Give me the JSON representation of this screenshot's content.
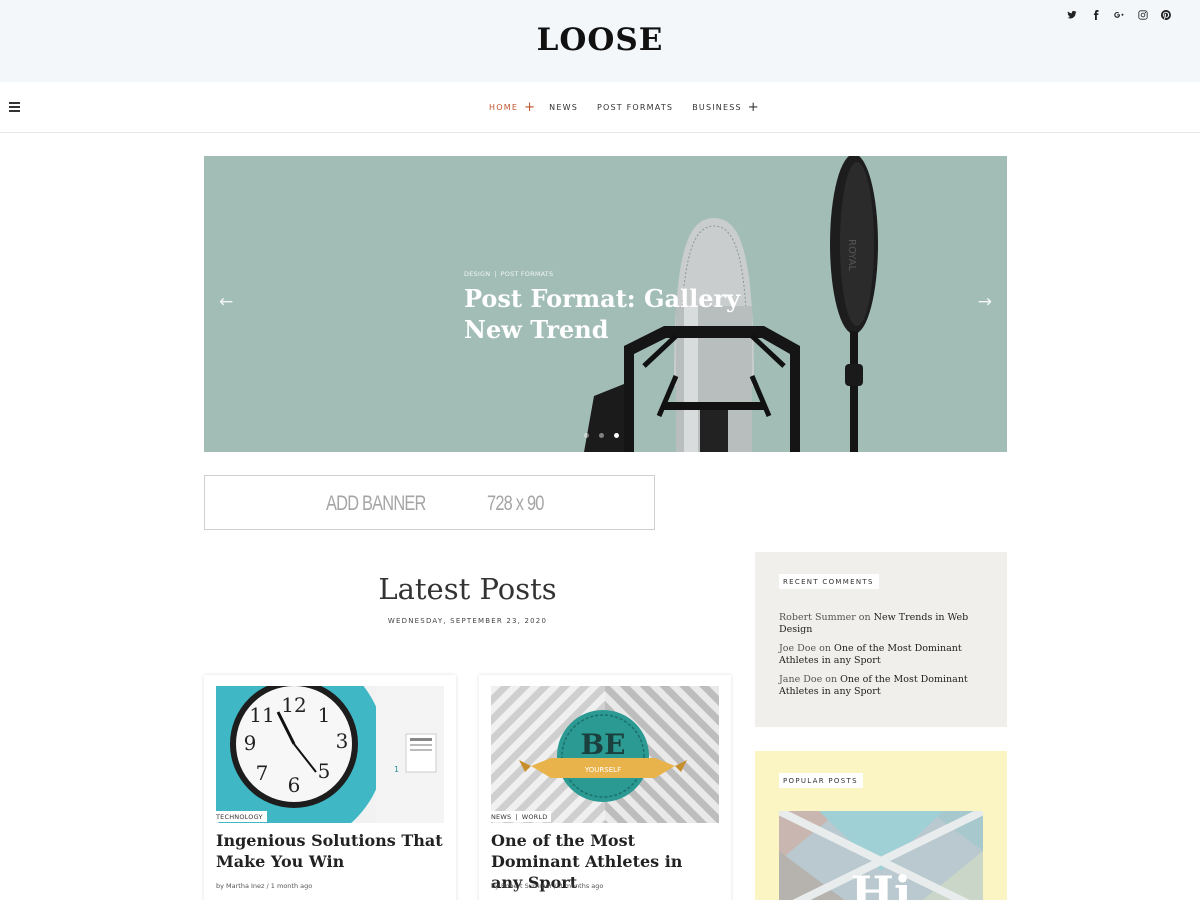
{
  "header": {
    "logo": "LOOSE",
    "social_icons": [
      "twitter-icon",
      "facebook-icon",
      "google-plus-icon",
      "instagram-icon",
      "pinterest-icon"
    ],
    "social_glyphs": [
      "t",
      "f",
      "G+",
      "ig",
      "p"
    ],
    "background": "#f4f7fa"
  },
  "nav": {
    "items": [
      {
        "label": "HOME",
        "active": true,
        "has_submenu": true
      },
      {
        "label": "NEWS",
        "active": false,
        "has_submenu": false
      },
      {
        "label": "POST FORMATS",
        "active": false,
        "has_submenu": false
      },
      {
        "label": "BUSINESS",
        "active": false,
        "has_submenu": true
      }
    ],
    "plus": "+",
    "accent_color": "#c0552d"
  },
  "hero": {
    "categories": [
      "DESIGN",
      "POST FORMATS"
    ],
    "separator": "|",
    "title": "Post Format: Gallery New Trend",
    "prev_arrow": "←",
    "next_arrow": "→",
    "dots": 3,
    "active_dot": 3,
    "background": "#a2bdb6"
  },
  "banner": {
    "text_left": "ADD BANNER",
    "text_right": "728 x 90"
  },
  "latest": {
    "title": "Latest Posts",
    "date": "WEDNESDAY, SEPTEMBER 23, 2020"
  },
  "posts": [
    {
      "categories": [
        "TECHNOLOGY"
      ],
      "title": "Ingenious Solutions That Make You Win",
      "meta": "by Martha Inez / 1 month ago"
    },
    {
      "categories": [
        "NEWS",
        "WORLD"
      ],
      "title": "One of the Most Dominant Athletes in any Sport",
      "meta": "by Robert Summer / 3 months ago"
    }
  ],
  "sidebar": {
    "recent_comments": {
      "label": "RECENT COMMENTS",
      "items": [
        {
          "author": "Robert Summer",
          "on": "on",
          "post": "New Trends in Web Design"
        },
        {
          "author": "Joe Doe",
          "on": "on",
          "post": "One of the Most Dominant Athletes in any Sport"
        },
        {
          "author": "Jane Doe",
          "on": "on",
          "post": "One of the Most Dominant Athletes in any Sport"
        }
      ]
    },
    "popular_posts": {
      "label": "POPULAR POSTS",
      "image_text": "Hi"
    }
  }
}
